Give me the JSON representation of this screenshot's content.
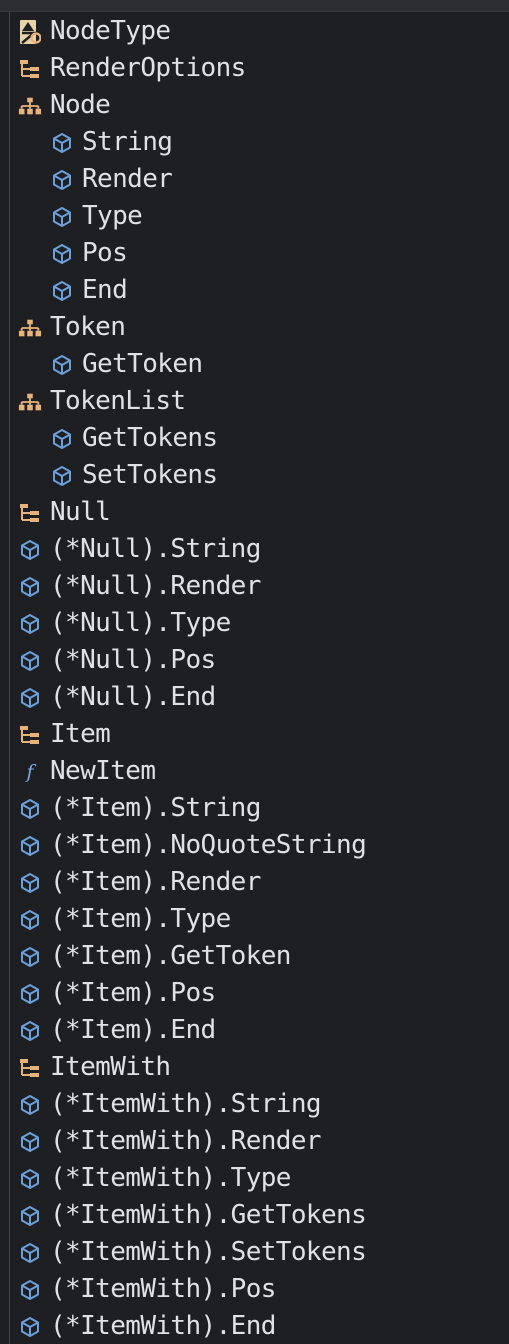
{
  "colors": {
    "background": "#1e1f22",
    "text": "#dfe1e5",
    "method_icon": "#6ca0dc",
    "type_icon": "#e8b37a",
    "function_icon": "#7aa6e8"
  },
  "outline": [
    {
      "label": "NodeType",
      "icon": "enum-type-icon",
      "level": 0
    },
    {
      "label": "RenderOptions",
      "icon": "struct-icon",
      "level": 0
    },
    {
      "label": "Node",
      "icon": "interface-icon",
      "level": 0
    },
    {
      "label": "String",
      "icon": "method-icon",
      "level": 1
    },
    {
      "label": "Render",
      "icon": "method-icon",
      "level": 1
    },
    {
      "label": "Type",
      "icon": "method-icon",
      "level": 1
    },
    {
      "label": "Pos",
      "icon": "method-icon",
      "level": 1
    },
    {
      "label": "End",
      "icon": "method-icon",
      "level": 1
    },
    {
      "label": "Token",
      "icon": "interface-icon",
      "level": 0
    },
    {
      "label": "GetToken",
      "icon": "method-icon",
      "level": 1
    },
    {
      "label": "TokenList",
      "icon": "interface-icon",
      "level": 0
    },
    {
      "label": "GetTokens",
      "icon": "method-icon",
      "level": 1
    },
    {
      "label": "SetTokens",
      "icon": "method-icon",
      "level": 1
    },
    {
      "label": "Null",
      "icon": "struct-icon",
      "level": 0
    },
    {
      "label": "(*Null).String",
      "icon": "method-icon",
      "level": 0
    },
    {
      "label": "(*Null).Render",
      "icon": "method-icon",
      "level": 0
    },
    {
      "label": "(*Null).Type",
      "icon": "method-icon",
      "level": 0
    },
    {
      "label": "(*Null).Pos",
      "icon": "method-icon",
      "level": 0
    },
    {
      "label": "(*Null).End",
      "icon": "method-icon",
      "level": 0
    },
    {
      "label": "Item",
      "icon": "struct-icon",
      "level": 0
    },
    {
      "label": "NewItem",
      "icon": "function-icon",
      "level": 0
    },
    {
      "label": "(*Item).String",
      "icon": "method-icon",
      "level": 0
    },
    {
      "label": "(*Item).NoQuoteString",
      "icon": "method-icon",
      "level": 0
    },
    {
      "label": "(*Item).Render",
      "icon": "method-icon",
      "level": 0
    },
    {
      "label": "(*Item).Type",
      "icon": "method-icon",
      "level": 0
    },
    {
      "label": "(*Item).GetToken",
      "icon": "method-icon",
      "level": 0
    },
    {
      "label": "(*Item).Pos",
      "icon": "method-icon",
      "level": 0
    },
    {
      "label": "(*Item).End",
      "icon": "method-icon",
      "level": 0
    },
    {
      "label": "ItemWith",
      "icon": "struct-icon",
      "level": 0
    },
    {
      "label": "(*ItemWith).String",
      "icon": "method-icon",
      "level": 0
    },
    {
      "label": "(*ItemWith).Render",
      "icon": "method-icon",
      "level": 0
    },
    {
      "label": "(*ItemWith).Type",
      "icon": "method-icon",
      "level": 0
    },
    {
      "label": "(*ItemWith).GetTokens",
      "icon": "method-icon",
      "level": 0
    },
    {
      "label": "(*ItemWith).SetTokens",
      "icon": "method-icon",
      "level": 0
    },
    {
      "label": "(*ItemWith).Pos",
      "icon": "method-icon",
      "level": 0
    },
    {
      "label": "(*ItemWith).End",
      "icon": "method-icon",
      "level": 0
    }
  ]
}
